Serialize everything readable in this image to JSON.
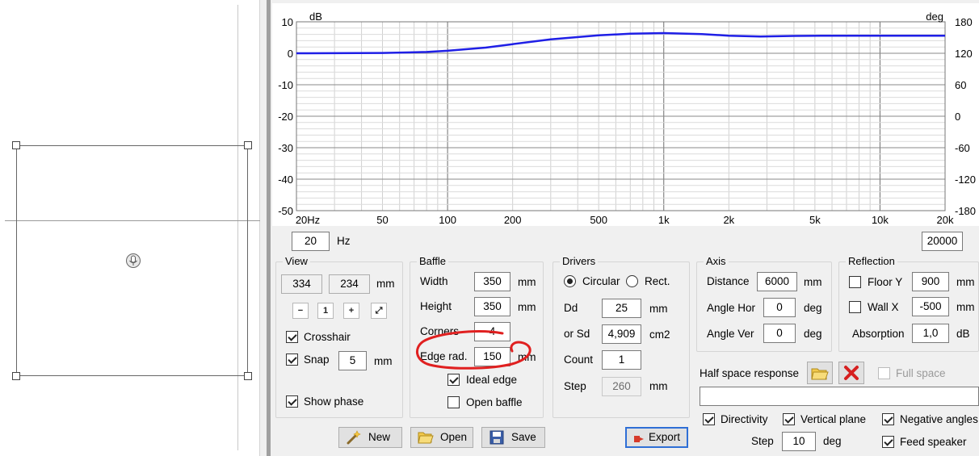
{
  "chart_data": {
    "type": "line",
    "x_scale": "log",
    "x_ticks": [
      "20Hz",
      "50",
      "100",
      "200",
      "500",
      "1k",
      "2k",
      "5k",
      "10k",
      "20k"
    ],
    "y_left_unit": "dB",
    "y_left_ticks": [
      "10",
      "0",
      "-10",
      "-20",
      "-30",
      "-40",
      "-50"
    ],
    "y_right_unit": "deg",
    "y_right_ticks": [
      "180",
      "120",
      "60",
      "0",
      "-60",
      "-120",
      "-180"
    ],
    "xlim": [
      20,
      20000
    ],
    "ylim": [
      -50,
      10
    ],
    "grid": true,
    "series": [
      {
        "color": "#1f1fe6",
        "x": [
          20,
          50,
          80,
          100,
          150,
          200,
          300,
          500,
          700,
          1000,
          1500,
          2000,
          2800,
          4000,
          6000,
          10000,
          20000
        ],
        "y": [
          0,
          0.1,
          0.4,
          0.8,
          1.8,
          2.9,
          4.4,
          5.7,
          6.2,
          6.4,
          6.1,
          5.6,
          5.3,
          5.5,
          5.6,
          5.6,
          5.6
        ]
      }
    ]
  },
  "freq_min": "20",
  "freq_unit": "Hz",
  "freq_max": "20000",
  "view": {
    "title": "View",
    "width": "334",
    "height": "234",
    "unit": "mm",
    "crosshair_label": "Crosshair",
    "snap_label": "Snap",
    "snap_value": "5",
    "snap_unit": "mm",
    "show_phase_label": "Show phase"
  },
  "baffle": {
    "title": "Baffle",
    "width_label": "Width",
    "width_value": "350",
    "height_label": "Height",
    "height_value": "350",
    "corners_label": "Corners",
    "corners_value": "4",
    "edge_label": "Edge rad.",
    "edge_value": "150",
    "unit": "mm",
    "ideal_edge_label": "Ideal edge",
    "open_baffle_label": "Open baffle"
  },
  "drivers": {
    "title": "Drivers",
    "circular_label": "Circular",
    "rect_label": "Rect.",
    "dd_label": "Dd",
    "dd_value": "25",
    "dd_unit": "mm",
    "sd_label": "or Sd",
    "sd_value": "4,909",
    "sd_unit": "cm2",
    "count_label": "Count",
    "count_value": "1",
    "step_label": "Step",
    "step_value": "260",
    "step_unit": "mm"
  },
  "axis": {
    "title": "Axis",
    "distance_label": "Distance",
    "distance_value": "6000",
    "distance_unit": "mm",
    "angle_hor_label": "Angle Hor",
    "angle_hor_value": "0",
    "angle_ver_label": "Angle Ver",
    "angle_ver_value": "0",
    "angle_unit": "deg"
  },
  "reflection": {
    "title": "Reflection",
    "floor_label": "Floor Y",
    "floor_value": "900",
    "wall_label": "Wall  X",
    "wall_value": "-500",
    "unit": "mm",
    "absorption_label": "Absorption",
    "absorption_value": "1,0",
    "absorption_unit": "dB"
  },
  "half_space": {
    "label": "Half space response",
    "full_space_label": "Full space",
    "path_value": ""
  },
  "options": {
    "directivity_label": "Directivity",
    "vertical_plane_label": "Vertical plane",
    "negative_angles_label": "Negative angles",
    "step_label": "Step",
    "step_value": "10",
    "step_unit": "deg",
    "feed_speaker_label": "Feed speaker"
  },
  "buttons": {
    "new_label": "New",
    "open_label": "Open",
    "save_label": "Save",
    "export_label": "Export"
  },
  "colors": {
    "curve": "#1f1fe6",
    "annotation": "#e02020"
  }
}
